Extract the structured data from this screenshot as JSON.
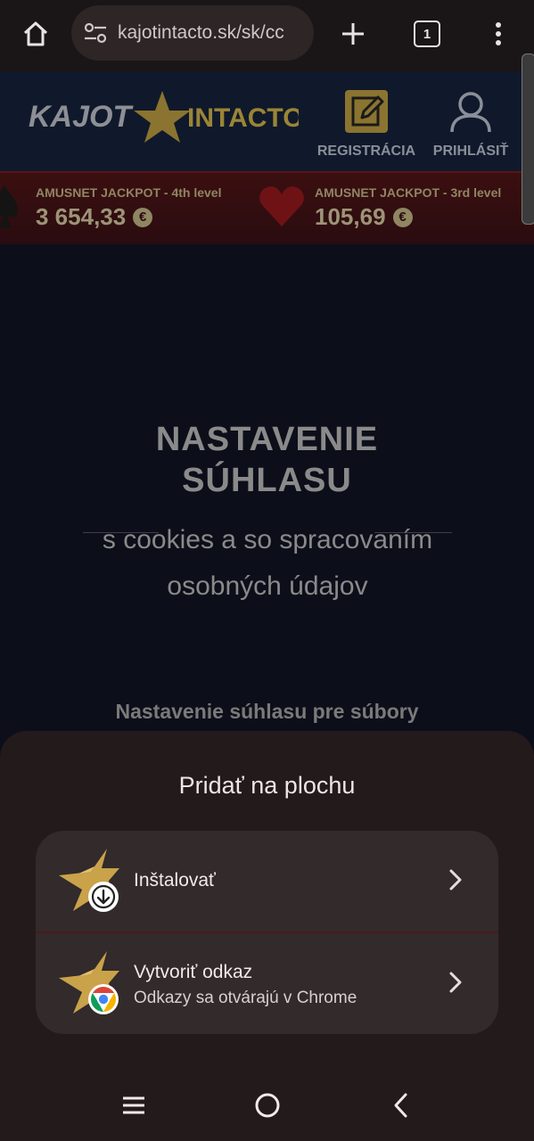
{
  "browser": {
    "url": "kajotintacto.sk/sk/cc",
    "tab_count": "1"
  },
  "site": {
    "logo_text": "KAJOT INTACTO",
    "logo_left": "KAJOT",
    "logo_right": "INTACTO",
    "register_label": "REGISTRÁCIA",
    "login_label": "PRIHLÁSIŤ",
    "jackpots": [
      {
        "label": "AMUSNET JACKPOT - 4th level",
        "value": "3 654,33",
        "currency": "€"
      },
      {
        "label": "AMUSNET JACKPOT - 3rd level",
        "value": "105,69",
        "currency": "€"
      }
    ],
    "consent_title_1": "NASTAVENIE",
    "consent_title_2": "SÚHLASU",
    "consent_subtitle": "s cookies a so spracovaním osobných údajov",
    "consent_heading": "Nastavenie súhlasu pre súbory"
  },
  "sheet": {
    "title": "Pridať na plochu",
    "options": [
      {
        "title": "Inštalovať",
        "subtitle": ""
      },
      {
        "title": "Vytvoriť odkaz",
        "subtitle": "Odkazy sa otvárajú v Chrome"
      }
    ]
  },
  "colors": {
    "sheet_bg": "#231a1b",
    "card_bg": "#322a2b",
    "gold": "#c9a24a"
  }
}
